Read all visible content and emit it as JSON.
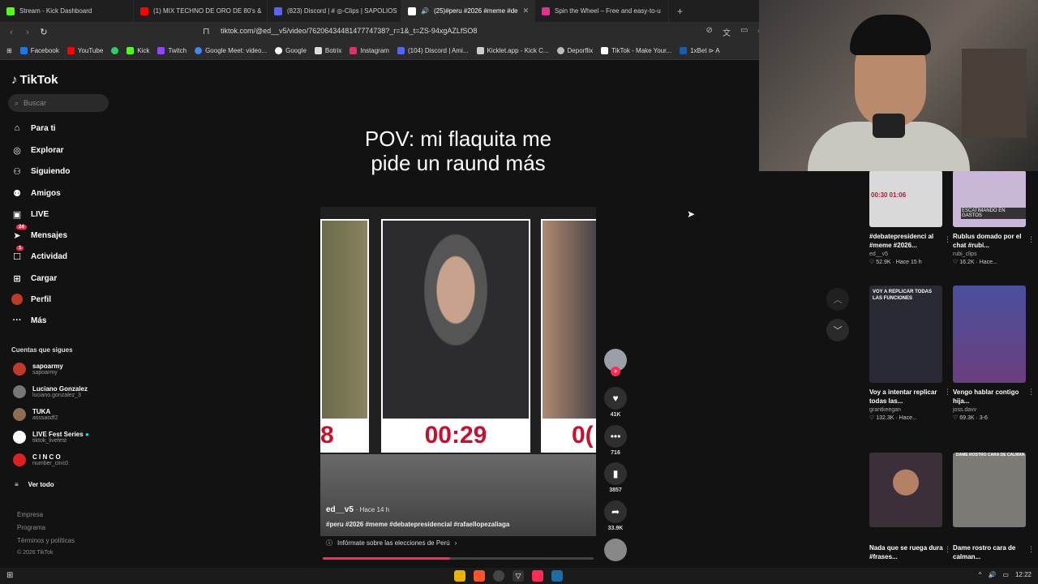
{
  "browser": {
    "tabs": [
      {
        "label": "Stream - Kick Dashboard",
        "color": "#53fc18"
      },
      {
        "label": "(1) MIX TECHNO DE ORO DE 80's &",
        "color": "#ff0000"
      },
      {
        "label": "(823) Discord | # ◎-Clips | SAPOLIOS",
        "color": "#5865f2"
      },
      {
        "label": "(25)#peru #2026 #meme #de",
        "color": "#ffffff"
      },
      {
        "label": "Spin the Wheel – Free and easy-to-u",
        "color": "#e0338f"
      }
    ],
    "url": "tiktok.com/@ed__v5/video/7620643448147774738?_r=1&_t=ZS-94xgAZLfSO8",
    "bookmarks": [
      "Facebook",
      "YouTube",
      "",
      "Kick",
      "Twitch",
      "Google Meet: video...",
      "Google",
      "Botrix",
      "Instagram",
      "(104) Discord | Ami...",
      "Kicklet.app - Kick C...",
      "Deporflix",
      "TikTok - Make Your...",
      "1xBet ⊳ A"
    ]
  },
  "tiktok": {
    "logo": "TikTok",
    "search_placeholder": "Buscar",
    "nav": [
      {
        "label": "Para ti",
        "icon": "home-icon"
      },
      {
        "label": "Explorar",
        "icon": "compass-icon"
      },
      {
        "label": "Siguiendo",
        "icon": "following-icon"
      },
      {
        "label": "Amigos",
        "icon": "friends-icon"
      },
      {
        "label": "LIVE",
        "icon": "live-icon"
      },
      {
        "label": "Mensajes",
        "icon": "messages-icon",
        "badge": "24"
      },
      {
        "label": "Actividad",
        "icon": "activity-icon",
        "badge": "1"
      },
      {
        "label": "Cargar",
        "icon": "upload-icon"
      },
      {
        "label": "Perfil",
        "icon": "profile-icon"
      },
      {
        "label": "Más",
        "icon": "more-icon"
      }
    ],
    "following_title": "Cuentas que sigues",
    "following": [
      {
        "name": "sapoarmy",
        "handle": "sapoarmy",
        "color": "#c0392b"
      },
      {
        "name": "Luciano Gonzalez",
        "handle": "luciano.gonzalez_3",
        "color": "#777"
      },
      {
        "name": "TUKA",
        "handle": "asssasdf2",
        "color": "#8e6e53"
      },
      {
        "name": "LIVE Fest Series",
        "handle": "tiktok_livefest",
        "color": "#ffffff"
      },
      {
        "name": "C I N C O",
        "handle": "number_cinc0",
        "color": "#e02020"
      }
    ],
    "see_all": "Ver todo",
    "footer": [
      "Empresa",
      "Programa",
      "Términos y políticas",
      "© 2026 TikTok"
    ]
  },
  "video": {
    "caption_line1": "POV: mi flaquita me",
    "caption_line2": "pide un  raund más",
    "timers": [
      "8",
      "00:29",
      "0("
    ],
    "author": "ed__v5",
    "age": "· Hace 14 h",
    "tags": "#peru #2026 #meme #debatepresidencial #rafaellopezaliaga",
    "info": "Infórmate sobre las elecciones de Perú",
    "progress": 0.47,
    "likes": "41K",
    "comments": "716",
    "saves": "3857",
    "shares": "33.9K"
  },
  "grid": [
    {
      "title": "#debatepresidenci al #meme #2026...",
      "author": "ed__v5",
      "stats": "♡ 52.9K · Hace 15 h",
      "bg": "#d9d9d9",
      "overlay": "00:30  01:06"
    },
    {
      "title": "Rublus domado por el chat #rubi...",
      "author": "rubi_clips",
      "stats": "♡ 16.2K · Hace...",
      "bg": "#c9b7d8",
      "overlay": "ESCATIMANDO EN GASTOS"
    },
    {
      "title": "Voy a intentar replicar todas las...",
      "author": "grantkeegan",
      "stats": "♡ 132.3K · Hace...",
      "bg": "#2a2a35",
      "overlay": "VOY A REPLICAR TODAS LAS FUNCIONES"
    },
    {
      "title": "Vengo hablar contigo hija...",
      "author": "joss.davv",
      "stats": "♡ 69.3K · 3-6",
      "bg": "#3a3f6e",
      "overlay": ""
    },
    {
      "title": "Nada que se ruega dura #frases...",
      "author": "",
      "stats": "",
      "bg": "#3b2f3a",
      "overlay": ""
    },
    {
      "title": "Dame rostro cara de calman...",
      "author": "",
      "stats": "",
      "bg": "#7c7a74",
      "overlay": "DAME ROSTRO CARA DE CALMAN"
    }
  ],
  "taskbar": {
    "time": "12:22"
  }
}
